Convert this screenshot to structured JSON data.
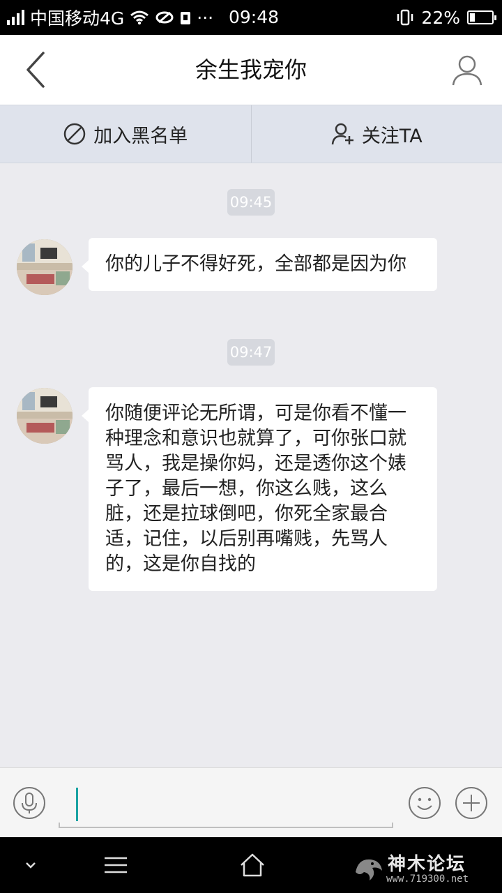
{
  "status_bar": {
    "carrier": "中国移动4G",
    "dots": "···",
    "time": "09:48",
    "battery": "22%"
  },
  "header": {
    "title": "余生我宠你"
  },
  "actions": {
    "blacklist_label": "加入黑名单",
    "follow_label": "关注TA"
  },
  "messages": [
    {
      "time": "09:45",
      "text": "你的儿子不得好死，全部都是因为你"
    },
    {
      "time": "09:47",
      "text": "你随便评论无所谓，可是你看不懂一种理念和意识也就算了，可你张口就骂人，我是操你妈，还是透你这个婊子了，最后一想，你这么贱，这么脏，还是拉球倒吧，你死全家最合适，记住，以后别再嘴贱，先骂人的，这是你自找的"
    }
  ],
  "input": {
    "value": ""
  },
  "watermark": {
    "title": "神木论坛",
    "url": "www.719300.net"
  },
  "colors": {
    "accent_cursor": "#1aa3a3",
    "chat_background": "#ebebef",
    "action_bar": "#dfe3ec"
  },
  "icons": [
    "back-arrow-icon",
    "profile-icon",
    "block-icon",
    "add-user-icon",
    "microphone-icon",
    "emoji-icon",
    "plus-icon",
    "chevron-down-icon",
    "menu-icon",
    "home-icon"
  ]
}
